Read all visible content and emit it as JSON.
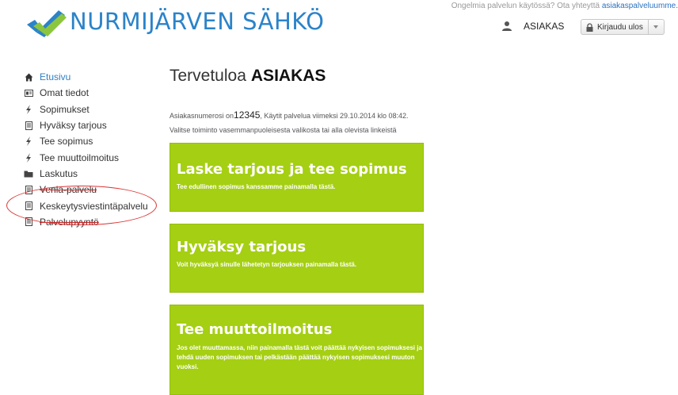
{
  "brand": {
    "name": "NURMIJÄRVEN SÄHKÖ",
    "blue": "#2b83c9",
    "green": "#a5cf12"
  },
  "header": {
    "help_text": "Ongelmia palvelun käytössä? Ota yhteyttä ",
    "help_link": "asiakaspalveluumme.",
    "user_name": "ASIAKAS",
    "logout_label": "Kirjaudu ulos",
    "user_icon": "user-icon",
    "lock_icon": "lock-icon"
  },
  "sidebar": {
    "items": [
      {
        "label": "Etusivu",
        "icon": "home-icon"
      },
      {
        "label": "Omat tiedot",
        "icon": "id-card-icon"
      },
      {
        "label": "Sopimukset",
        "icon": "bolt-icon"
      },
      {
        "label": "Hyväksy tarjous",
        "icon": "document-icon"
      },
      {
        "label": "Tee sopimus",
        "icon": "bolt-icon"
      },
      {
        "label": "Tee muuttoilmoitus",
        "icon": "bolt-icon"
      },
      {
        "label": "Laskutus",
        "icon": "folder-icon"
      },
      {
        "label": "Venla-palvelu",
        "icon": "document-icon"
      },
      {
        "label": "Keskeytysviestintäpalvelu",
        "icon": "document-icon"
      },
      {
        "label": "Palvelupyyntö",
        "icon": "document-icon"
      }
    ]
  },
  "main": {
    "welcome": "Tervetuloa",
    "customer": "ASIAKAS",
    "info_prefix": "Asiakasnumerosi on",
    "customer_number": "12345",
    "info_suffix": ", Käytit palvelua viimeksi 29.10.2014 klo 08:42.",
    "instruction": "Valitse toiminto vasemmanpuoleisesta valikosta tai alla olevista linkeistä",
    "tiles": [
      {
        "title": "Laske tarjous ja tee sopimus",
        "text": "Tee edullinen sopimus kanssamme painamalla tästä."
      },
      {
        "title": "Hyväksy tarjous",
        "text": "Voit hyväksyä sinulle lähetetyn tarjouksen painamalla tästä."
      },
      {
        "title": "Tee muuttoilmoitus",
        "text": "Jos olet muuttamassa, niin painamalla tästä voit päättää nykyisen sopimuksesi ja tehdä uuden sopimuksen tai pelkästään päättää nykyisen sopimuksesi muuton vuoksi."
      }
    ]
  }
}
